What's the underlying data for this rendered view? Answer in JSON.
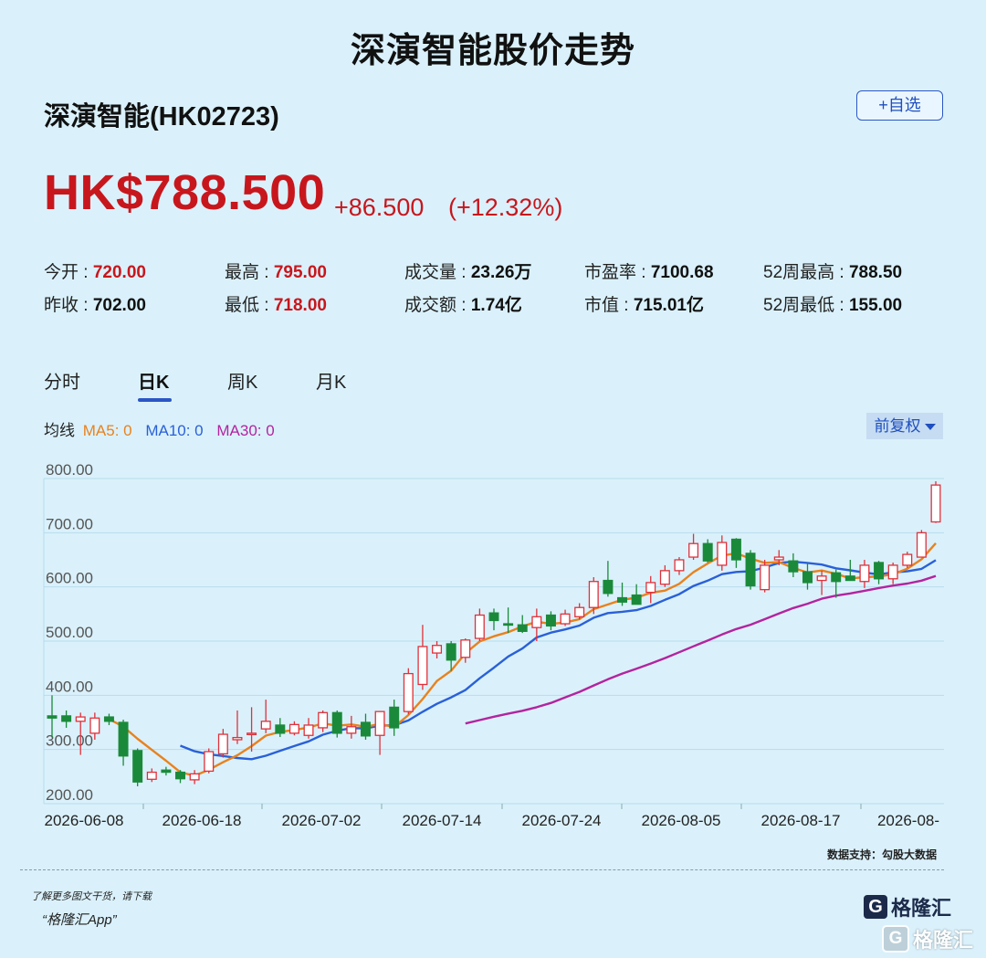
{
  "page_title": "深演智能股价走势",
  "stock": {
    "name": "深演智能(HK02723)",
    "watch_label": "+自选",
    "price": "HK$788.500",
    "change": "+86.500",
    "change_pct": "(+12.32%)"
  },
  "stats": [
    {
      "label": "今开 : ",
      "value": "720.00",
      "red": true
    },
    {
      "label": "最高 : ",
      "value": "795.00",
      "red": true
    },
    {
      "label": "成交量 : ",
      "value": "23.26万",
      "red": false
    },
    {
      "label": "市盈率 : ",
      "value": "7100.68",
      "red": false
    },
    {
      "label": "52周最高 : ",
      "value": "788.50",
      "red": false
    },
    {
      "label": "昨收 : ",
      "value": "702.00",
      "red": false
    },
    {
      "label": "最低 : ",
      "value": "718.00",
      "red": true
    },
    {
      "label": "成交额 : ",
      "value": "1.74亿",
      "red": false
    },
    {
      "label": "市值 : ",
      "value": "715.01亿",
      "red": false
    },
    {
      "label": "52周最低 : ",
      "value": "155.00",
      "red": false
    }
  ],
  "tabs": [
    {
      "label": "分时",
      "active": false
    },
    {
      "label": "日K",
      "active": true
    },
    {
      "label": "周K",
      "active": false
    },
    {
      "label": "月K",
      "active": false
    }
  ],
  "ma_legend": {
    "label": "均线",
    "ma5": "MA5: 0",
    "ma10": "MA10: 0",
    "ma30": "MA30: 0"
  },
  "adjust_label": "前复权",
  "colors": {
    "up": "#e0303a",
    "down": "#1a8a3a",
    "ma5": "#e8821e",
    "ma10": "#2a60d8",
    "ma30": "#b3249f",
    "price": "#c8161d"
  },
  "chart_data": {
    "type": "candlestick",
    "y_ticks": [
      "800.00",
      "700.00",
      "600.00",
      "500.00",
      "400.00",
      "300.00",
      "200.00"
    ],
    "ylim": [
      200,
      800
    ],
    "x_labels": [
      "2026-06-08",
      "2026-06-18",
      "2026-07-02",
      "2026-07-14",
      "2026-07-24",
      "2026-08-05",
      "2026-08-17",
      "2026-08-"
    ],
    "candles": [
      {
        "o": 362,
        "h": 400,
        "l": 322,
        "c": 358
      },
      {
        "o": 362,
        "h": 372,
        "l": 340,
        "c": 352
      },
      {
        "o": 352,
        "h": 368,
        "l": 290,
        "c": 360
      },
      {
        "o": 330,
        "h": 368,
        "l": 318,
        "c": 358
      },
      {
        "o": 360,
        "h": 366,
        "l": 345,
        "c": 352
      },
      {
        "o": 350,
        "h": 355,
        "l": 270,
        "c": 288
      },
      {
        "o": 298,
        "h": 302,
        "l": 232,
        "c": 240
      },
      {
        "o": 245,
        "h": 265,
        "l": 240,
        "c": 258
      },
      {
        "o": 262,
        "h": 268,
        "l": 252,
        "c": 258
      },
      {
        "o": 258,
        "h": 262,
        "l": 238,
        "c": 246
      },
      {
        "o": 244,
        "h": 262,
        "l": 236,
        "c": 255
      },
      {
        "o": 260,
        "h": 302,
        "l": 256,
        "c": 296
      },
      {
        "o": 292,
        "h": 338,
        "l": 285,
        "c": 328
      },
      {
        "o": 318,
        "h": 372,
        "l": 310,
        "c": 322
      },
      {
        "o": 330,
        "h": 378,
        "l": 296,
        "c": 330
      },
      {
        "o": 338,
        "h": 392,
        "l": 330,
        "c": 352
      },
      {
        "o": 345,
        "h": 358,
        "l": 323,
        "c": 330
      },
      {
        "o": 330,
        "h": 352,
        "l": 326,
        "c": 346
      },
      {
        "o": 326,
        "h": 358,
        "l": 320,
        "c": 345
      },
      {
        "o": 340,
        "h": 372,
        "l": 332,
        "c": 368
      },
      {
        "o": 368,
        "h": 372,
        "l": 322,
        "c": 330
      },
      {
        "o": 330,
        "h": 362,
        "l": 320,
        "c": 342
      },
      {
        "o": 350,
        "h": 366,
        "l": 318,
        "c": 325
      },
      {
        "o": 326,
        "h": 368,
        "l": 290,
        "c": 370
      },
      {
        "o": 378,
        "h": 392,
        "l": 325,
        "c": 340
      },
      {
        "o": 370,
        "h": 450,
        "l": 365,
        "c": 440
      },
      {
        "o": 420,
        "h": 530,
        "l": 410,
        "c": 490
      },
      {
        "o": 478,
        "h": 500,
        "l": 468,
        "c": 492
      },
      {
        "o": 495,
        "h": 500,
        "l": 445,
        "c": 465
      },
      {
        "o": 470,
        "h": 505,
        "l": 460,
        "c": 502
      },
      {
        "o": 505,
        "h": 560,
        "l": 500,
        "c": 548
      },
      {
        "o": 552,
        "h": 560,
        "l": 520,
        "c": 538
      },
      {
        "o": 532,
        "h": 562,
        "l": 515,
        "c": 530
      },
      {
        "o": 530,
        "h": 548,
        "l": 515,
        "c": 518
      },
      {
        "o": 525,
        "h": 560,
        "l": 500,
        "c": 545
      },
      {
        "o": 548,
        "h": 555,
        "l": 520,
        "c": 528
      },
      {
        "o": 532,
        "h": 558,
        "l": 528,
        "c": 550
      },
      {
        "o": 545,
        "h": 570,
        "l": 540,
        "c": 562
      },
      {
        "o": 562,
        "h": 618,
        "l": 550,
        "c": 610
      },
      {
        "o": 612,
        "h": 648,
        "l": 582,
        "c": 588
      },
      {
        "o": 580,
        "h": 608,
        "l": 565,
        "c": 572
      },
      {
        "o": 585,
        "h": 605,
        "l": 568,
        "c": 568
      },
      {
        "o": 590,
        "h": 620,
        "l": 570,
        "c": 608
      },
      {
        "o": 605,
        "h": 640,
        "l": 600,
        "c": 630
      },
      {
        "o": 630,
        "h": 655,
        "l": 622,
        "c": 650
      },
      {
        "o": 655,
        "h": 698,
        "l": 650,
        "c": 680
      },
      {
        "o": 680,
        "h": 688,
        "l": 645,
        "c": 648
      },
      {
        "o": 640,
        "h": 695,
        "l": 630,
        "c": 682
      },
      {
        "o": 688,
        "h": 690,
        "l": 635,
        "c": 650
      },
      {
        "o": 662,
        "h": 668,
        "l": 595,
        "c": 602
      },
      {
        "o": 595,
        "h": 650,
        "l": 590,
        "c": 640
      },
      {
        "o": 650,
        "h": 668,
        "l": 640,
        "c": 655
      },
      {
        "o": 648,
        "h": 662,
        "l": 618,
        "c": 628
      },
      {
        "o": 628,
        "h": 645,
        "l": 595,
        "c": 608
      },
      {
        "o": 612,
        "h": 630,
        "l": 585,
        "c": 620
      },
      {
        "o": 626,
        "h": 632,
        "l": 580,
        "c": 610
      },
      {
        "o": 620,
        "h": 650,
        "l": 612,
        "c": 612
      },
      {
        "o": 610,
        "h": 650,
        "l": 598,
        "c": 640
      },
      {
        "o": 645,
        "h": 648,
        "l": 605,
        "c": 615
      },
      {
        "o": 615,
        "h": 645,
        "l": 605,
        "c": 640
      },
      {
        "o": 640,
        "h": 665,
        "l": 635,
        "c": 660
      },
      {
        "o": 655,
        "h": 705,
        "l": 655,
        "c": 700
      },
      {
        "o": 720,
        "h": 795,
        "l": 718,
        "c": 788
      }
    ]
  }
}
